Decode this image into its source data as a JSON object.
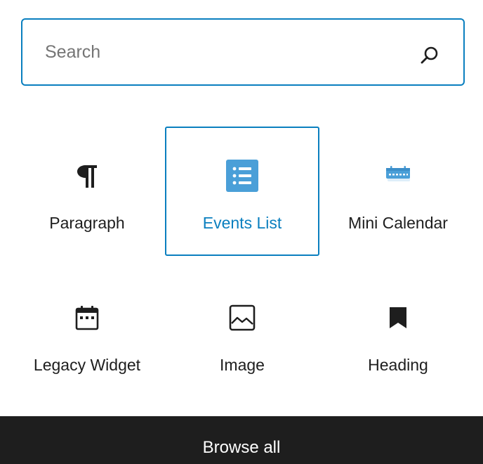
{
  "search": {
    "placeholder": "Search",
    "value": ""
  },
  "blocks": [
    {
      "label": "Paragraph",
      "icon": "paragraph-icon",
      "selected": false
    },
    {
      "label": "Events List",
      "icon": "events-list-icon",
      "selected": true
    },
    {
      "label": "Mini Calendar",
      "icon": "mini-calendar-icon",
      "selected": false
    },
    {
      "label": "Legacy Widget",
      "icon": "calendar-widget-icon",
      "selected": false
    },
    {
      "label": "Image",
      "icon": "image-icon",
      "selected": false
    },
    {
      "label": "Heading",
      "icon": "bookmark-icon",
      "selected": false
    }
  ],
  "footer": {
    "browse_all_label": "Browse all"
  },
  "colors": {
    "accent": "#0a7fbf",
    "events_icon_bg": "#4a9fd8",
    "text": "#1e1e1e",
    "footer_bg": "#1e1e1e"
  }
}
